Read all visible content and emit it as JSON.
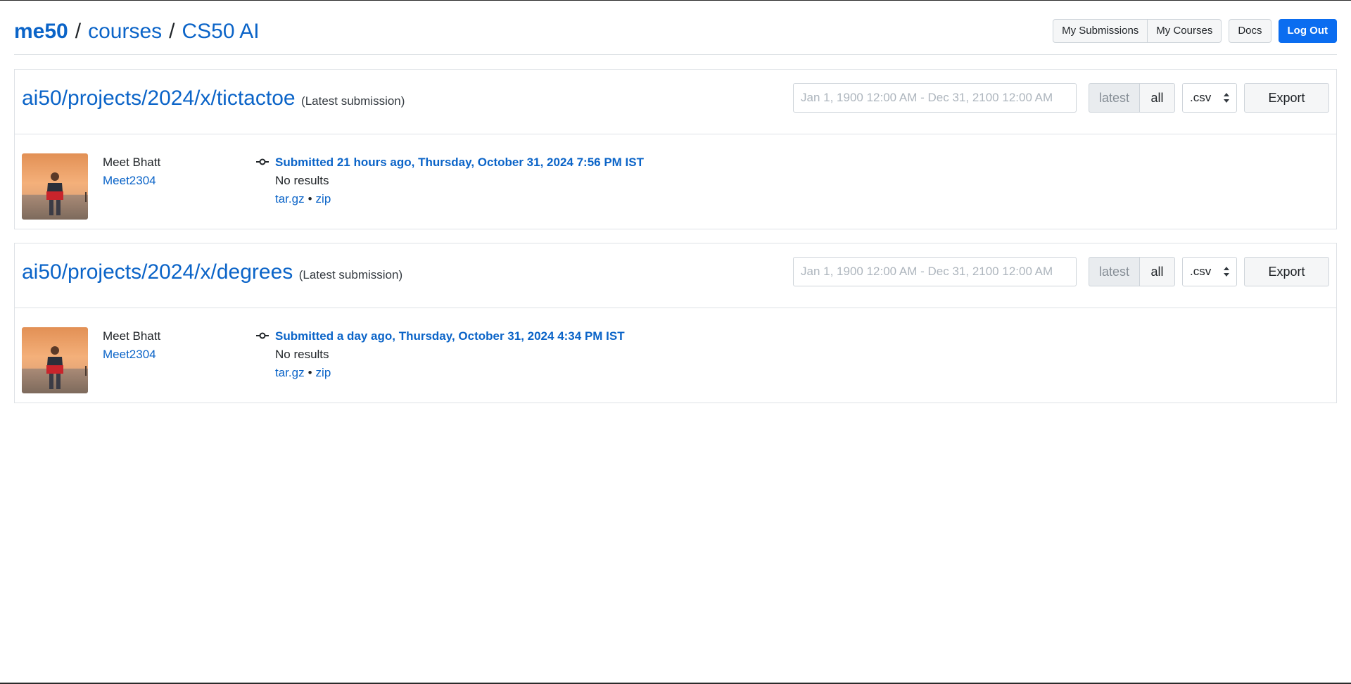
{
  "breadcrumb": {
    "brand": "me50",
    "separator": "/",
    "courses": "courses",
    "course": "CS50 AI"
  },
  "nav": {
    "my_submissions": "My Submissions",
    "my_courses": "My Courses",
    "docs": "Docs",
    "log_out": "Log Out"
  },
  "colors": {
    "link": "#0b64c8",
    "primary_button": "#0b6df0"
  },
  "projects": [
    {
      "path": "ai50/projects/2024/x/tictactoe",
      "tag": "(Latest submission)",
      "date_range_placeholder": "Jan 1, 1900 12:00 AM - Dec 31, 2100 12:00 AM",
      "toggle_latest": "latest",
      "toggle_all": "all",
      "format": ".csv",
      "export_label": "Export",
      "submission": {
        "user_name": "Meet Bhatt",
        "username": "Meet2304",
        "icon": "commit-icon",
        "submitted": "Submitted 21 hours ago, Thursday, October 31, 2024 7:56 PM IST",
        "result": "No results",
        "download_targz": "tar.gz",
        "download_separator": "•",
        "download_zip": "zip"
      }
    },
    {
      "path": "ai50/projects/2024/x/degrees",
      "tag": "(Latest submission)",
      "date_range_placeholder": "Jan 1, 1900 12:00 AM - Dec 31, 2100 12:00 AM",
      "toggle_latest": "latest",
      "toggle_all": "all",
      "format": ".csv",
      "export_label": "Export",
      "submission": {
        "user_name": "Meet Bhatt",
        "username": "Meet2304",
        "icon": "commit-icon",
        "submitted": "Submitted a day ago, Thursday, October 31, 2024 4:34 PM IST",
        "result": "No results",
        "download_targz": "tar.gz",
        "download_separator": "•",
        "download_zip": "zip"
      }
    }
  ]
}
